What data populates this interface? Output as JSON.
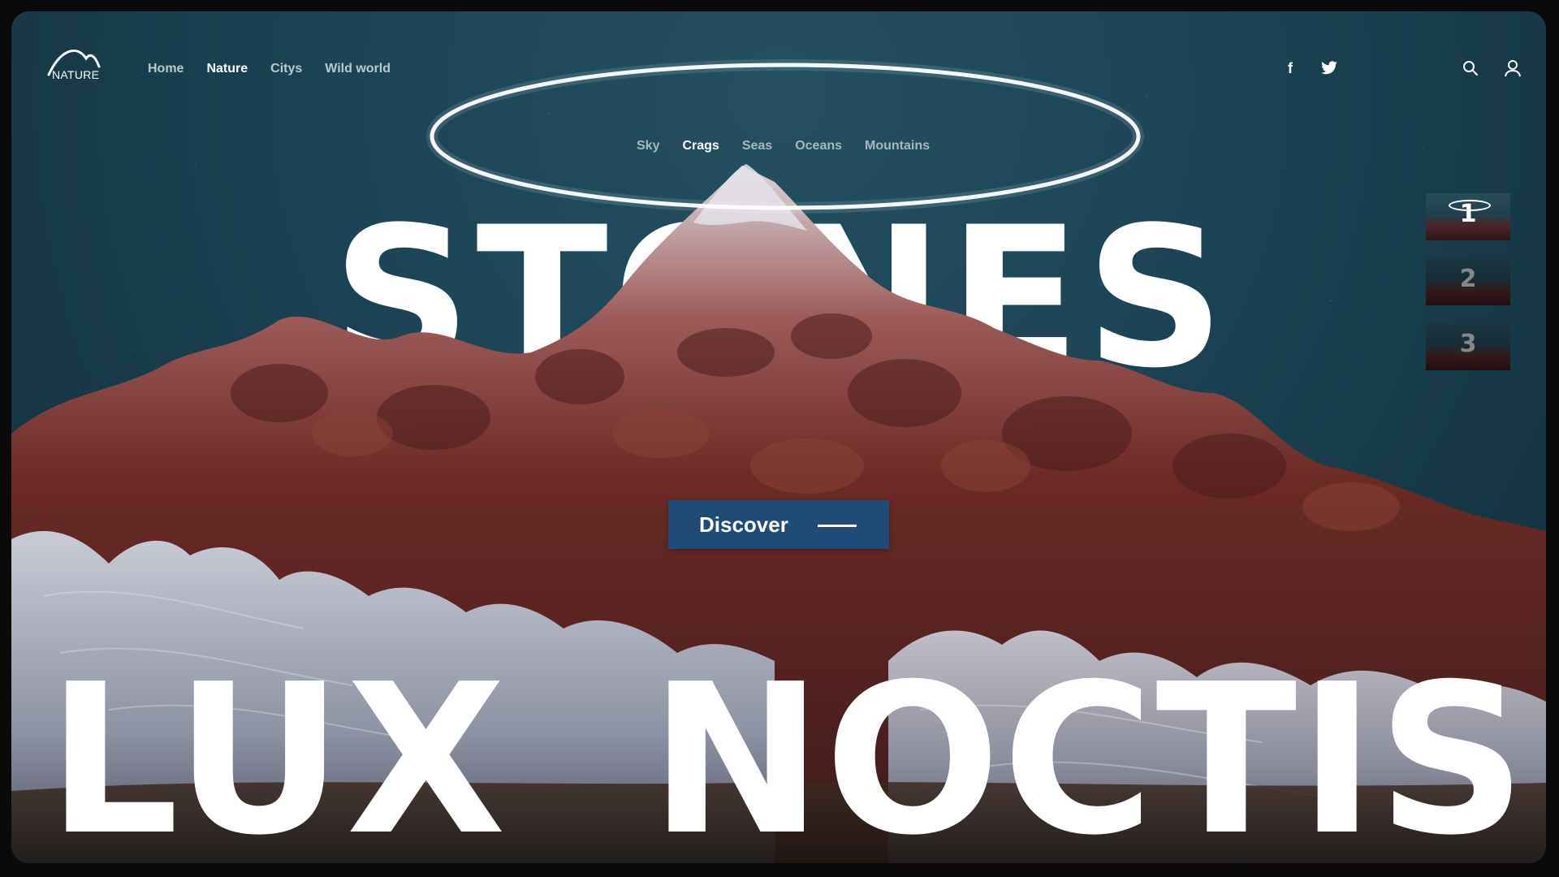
{
  "brand": {
    "logo_label": "NATURE",
    "logo_icon": "mountain-arc-icon"
  },
  "nav": {
    "items": [
      {
        "label": "Home",
        "active": false
      },
      {
        "label": "Nature",
        "active": true
      },
      {
        "label": "Citys",
        "active": false
      },
      {
        "label": "Wild world",
        "active": false
      }
    ]
  },
  "social": {
    "facebook": "f",
    "twitter_icon": "twitter-icon"
  },
  "utility": {
    "search_icon": "search-icon",
    "user_icon": "user-icon"
  },
  "subnav": {
    "items": [
      {
        "label": "Sky",
        "active": false
      },
      {
        "label": "Crags",
        "active": true
      },
      {
        "label": "Seas",
        "active": false
      },
      {
        "label": "Oceans",
        "active": false
      },
      {
        "label": "Mountains",
        "active": false
      }
    ]
  },
  "hero": {
    "headline": "STONES",
    "subtitle_left": "LUX",
    "subtitle_right": "NOCTIS",
    "cta_label": "Discover"
  },
  "slides": [
    {
      "number": "1",
      "active": true
    },
    {
      "number": "2",
      "active": false
    },
    {
      "number": "3",
      "active": false
    }
  ],
  "colors": {
    "sky": "#1c4454",
    "cta": "#1f4b76",
    "rock_red": "#6b2a26",
    "rock_white": "#b9bfcc"
  }
}
